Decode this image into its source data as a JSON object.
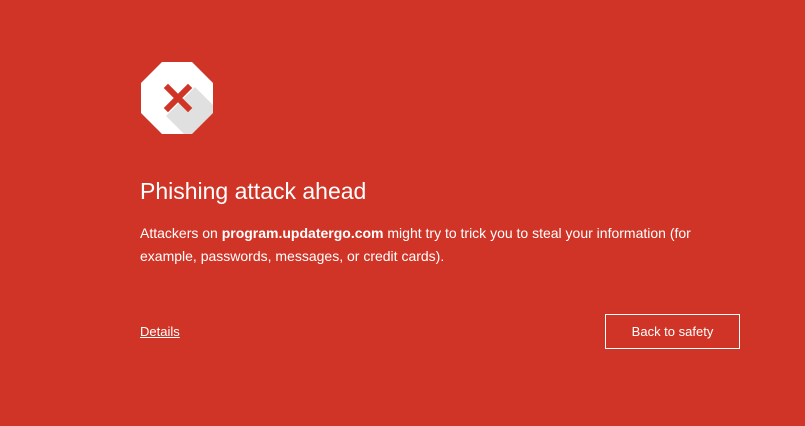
{
  "colors": {
    "background": "#cf3426",
    "text": "#ffffff",
    "icon_fill": "#ffffff",
    "icon_x": "#cf3426"
  },
  "icon": {
    "name": "stop-sign-x-icon"
  },
  "warning": {
    "title": "Phishing attack ahead",
    "message_before": "Attackers on ",
    "domain": "program.updatergo.com",
    "message_after": " might try to trick you to steal your information (for example, passwords, messages, or credit cards)."
  },
  "actions": {
    "details_label": "Details",
    "back_label": "Back to safety"
  }
}
